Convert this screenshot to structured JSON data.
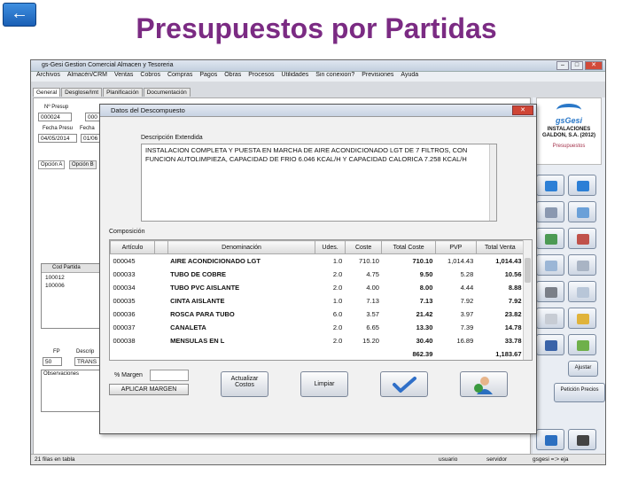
{
  "slide": {
    "title": "Presupuestos por Partidas",
    "back_icon": "arrow-left-icon",
    "back_glyph": "←"
  },
  "app": {
    "title": "gs-Gesi Gestion Comercial Almacen y Tesoreria",
    "menu": [
      "Archivos",
      "Almacén/CRM",
      "Ventas",
      "Cobros",
      "Compras",
      "Pagos",
      "Obras",
      "Procesos",
      "Utilidades",
      "Sin conexion?",
      "Previsiones",
      "Ayuda"
    ],
    "tabs": [
      "General",
      "Desglose/Imt",
      "Planificación",
      "Documentación"
    ],
    "fields": {
      "npresup_label": "Nº Presup",
      "npresup": "000024",
      "npresup2": "000",
      "fecha_label": "Fecha Presu",
      "fecha": "04/05/2014",
      "fecha2_label": "Fecha",
      "fecha2": "01/06",
      "opcion_a": "Opción A",
      "opcion_b": "Opción B",
      "cod_partida_label": "Cod Partida",
      "partidas": [
        "100012",
        "100006"
      ],
      "fp_label": "FP",
      "fp": "50",
      "descrip_label": "Descrip",
      "descrip": "TRANS",
      "obs_label": "Observaciones"
    },
    "status": {
      "rows": "21 filas en tabla",
      "usuario": "usuario",
      "servidor": "servidor",
      "gsgesi": "gsgesi =:> eja"
    },
    "logo": {
      "brand": "gsGesi",
      "company": "INSTALACIONES GALDON, S.A. (2012)",
      "module": "Presupuestos"
    },
    "right_buttons": {
      "ajustar": "Ajustar",
      "peticion": "Petición Precios"
    }
  },
  "dialog": {
    "title": "Datos del Descompuesto",
    "desc_label": "Descripción Extendida",
    "description": "INSTALACION COMPLETA Y PUESTA EN MARCHA DE AIRE ACONDICIONADO LGT DE 7 FILTROS, CON FUNCION AUTOLIMPIEZA, CAPACIDAD DE FRIO 6.046 Kcal/h Y CAPACIDAD CALORICA 7.258 Kcal/h",
    "composicion_label": "Composición",
    "columns": [
      "Artículo",
      "",
      "Denominación",
      "Udes.",
      "Coste",
      "Total Coste",
      "PVP",
      "Total Venta"
    ],
    "rows": [
      {
        "articulo": "000045",
        "denominacion": "AIRE ACONDICIONADO LGT",
        "udes": "1.0",
        "coste": "710.10",
        "total_coste": "710.10",
        "pvp": "1,014.43",
        "total_venta": "1,014.43"
      },
      {
        "articulo": "000033",
        "denominacion": "TUBO DE COBRE",
        "udes": "2.0",
        "coste": "4.75",
        "total_coste": "9.50",
        "pvp": "5.28",
        "total_venta": "10.56"
      },
      {
        "articulo": "000034",
        "denominacion": "TUBO PVC AISLANTE",
        "udes": "2.0",
        "coste": "4.00",
        "total_coste": "8.00",
        "pvp": "4.44",
        "total_venta": "8.88"
      },
      {
        "articulo": "000035",
        "denominacion": "CINTA AISLANTE",
        "udes": "1.0",
        "coste": "7.13",
        "total_coste": "7.13",
        "pvp": "7.92",
        "total_venta": "7.92"
      },
      {
        "articulo": "000036",
        "denominacion": "ROSCA PARA TUBO",
        "udes": "6.0",
        "coste": "3.57",
        "total_coste": "21.42",
        "pvp": "3.97",
        "total_venta": "23.82"
      },
      {
        "articulo": "000037",
        "denominacion": "CANALETA",
        "udes": "2.0",
        "coste": "6.65",
        "total_coste": "13.30",
        "pvp": "7.39",
        "total_venta": "14.78"
      },
      {
        "articulo": "000038",
        "denominacion": "MENSULAS EN L",
        "udes": "2.0",
        "coste": "15.20",
        "total_coste": "30.40",
        "pvp": "16.89",
        "total_venta": "33.78"
      }
    ],
    "totals": {
      "total_coste": "862.39",
      "total_venta": "1,183.67"
    },
    "margin_label": "% Margen",
    "aplicar_label": "APLICAR MARGEN",
    "actualizar_label": "Actualizar Costos",
    "limpiar_label": "Limpiar",
    "accept_icon": "checkmark-icon",
    "exit_icon": "user-exit-icon"
  }
}
